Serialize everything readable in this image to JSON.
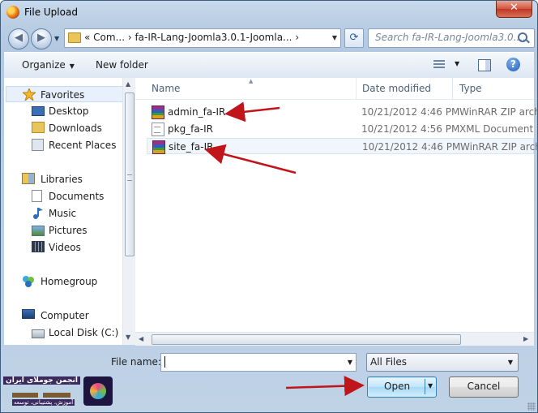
{
  "window": {
    "title": "File Upload",
    "close_glyph": "✕"
  },
  "address": {
    "path": "« Com... › fa-IR-Lang-Joomla3.0.1-Joomla... ›",
    "search_placeholder": "Search fa-IR-Lang-Joomla3.0...."
  },
  "toolbar": {
    "organize": "Organize",
    "new_folder": "New folder",
    "help": "?"
  },
  "nav": {
    "favorites": "Favorites",
    "desktop": "Desktop",
    "downloads": "Downloads",
    "recent": "Recent Places",
    "libraries": "Libraries",
    "documents": "Documents",
    "music": "Music",
    "pictures": "Pictures",
    "videos": "Videos",
    "homegroup": "Homegroup",
    "computer": "Computer",
    "local_disk": "Local Disk (C:)"
  },
  "columns": {
    "name": "Name",
    "date": "Date modified",
    "type": "Type"
  },
  "files": [
    {
      "name": "admin_fa-IR",
      "date": "10/21/2012 4:46 PM",
      "type": "WinRAR ZIP arch",
      "icon": "winrar-icon"
    },
    {
      "name": "pkg_fa-IR",
      "date": "10/21/2012 4:56 PM",
      "type": "XML Document",
      "icon": "xml-file-icon"
    },
    {
      "name": "site_fa-IR",
      "date": "10/21/2012 4:46 PM",
      "type": "WinRAR ZIP arch",
      "icon": "winrar-icon"
    }
  ],
  "bottom": {
    "file_name_label": "File name:",
    "file_name_value": "",
    "filter": "All Files",
    "open": "Open",
    "cancel": "Cancel"
  },
  "colors": {
    "arrow": "#c0151a",
    "accent": "#3c7fb1"
  },
  "logo": {
    "title": "انجمن جوملای ایران",
    "subtitle": "آموزش، پشتیبانی، توسعه"
  }
}
